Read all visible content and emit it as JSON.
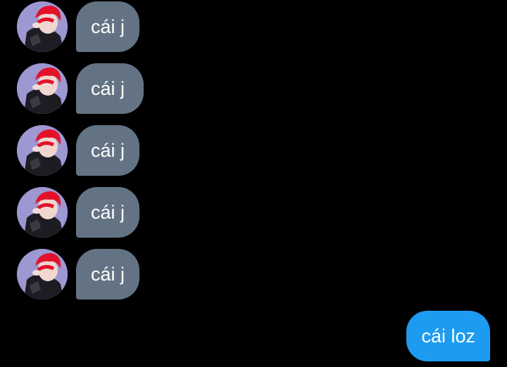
{
  "thread": {
    "incoming": [
      {
        "text": "cái j"
      },
      {
        "text": "cái j"
      },
      {
        "text": "cái j"
      },
      {
        "text": "cái j"
      },
      {
        "text": "cái j"
      }
    ],
    "outgoing": [
      {
        "text": "cái loz"
      }
    ]
  },
  "colors": {
    "background": "#000000",
    "incoming_bubble": "#637383",
    "outgoing_bubble": "#1d9bf0",
    "text": "#ffffff"
  },
  "icons": {
    "avatar": "user-avatar-photo"
  }
}
